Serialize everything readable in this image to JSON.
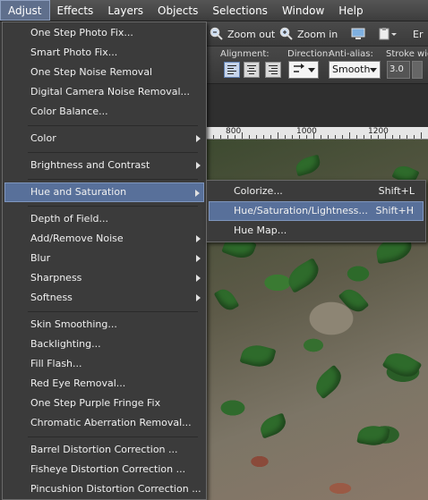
{
  "menubar": {
    "items": [
      "Adjust",
      "Effects",
      "Layers",
      "Objects",
      "Selections",
      "Window",
      "Help"
    ]
  },
  "toolbar": {
    "zoom_out": "Zoom out",
    "zoom_in": "Zoom in",
    "trailing": "Er",
    "alignment_label": "Alignment:",
    "direction_label": "Direction:",
    "antialias_label": "Anti-alias:",
    "stroke_label": "Stroke widt",
    "antialias_value": "Smooth",
    "stroke_value": "3.0"
  },
  "ruler": {
    "labels": [
      "800",
      "1000",
      "1200"
    ]
  },
  "adjust_menu": {
    "items": [
      {
        "label": "One Step Photo Fix...",
        "submenu": false
      },
      {
        "label": "Smart Photo Fix...",
        "submenu": false
      },
      {
        "label": "One Step Noise Removal",
        "submenu": false
      },
      {
        "label": "Digital Camera Noise Removal...",
        "submenu": false
      },
      {
        "label": "Color Balance...",
        "submenu": false
      },
      {
        "label": "Color",
        "submenu": true
      },
      {
        "label": "Brightness and Contrast",
        "submenu": true
      },
      {
        "label": "Hue and Saturation",
        "submenu": true
      },
      {
        "label": "Depth of Field...",
        "submenu": false
      },
      {
        "label": "Add/Remove Noise",
        "submenu": true
      },
      {
        "label": "Blur",
        "submenu": true
      },
      {
        "label": "Sharpness",
        "submenu": true
      },
      {
        "label": "Softness",
        "submenu": true
      },
      {
        "label": "Skin Smoothing...",
        "submenu": false
      },
      {
        "label": "Backlighting...",
        "submenu": false
      },
      {
        "label": "Fill Flash...",
        "submenu": false
      },
      {
        "label": "Red Eye Removal...",
        "submenu": false
      },
      {
        "label": "One Step Purple Fringe Fix",
        "submenu": false
      },
      {
        "label": "Chromatic Aberration Removal...",
        "submenu": false
      },
      {
        "label": "Barrel Distortion Correction ...",
        "submenu": false
      },
      {
        "label": "Fisheye Distortion Correction ...",
        "submenu": false
      },
      {
        "label": "Pincushion Distortion Correction ...",
        "submenu": false
      }
    ]
  },
  "hue_submenu": {
    "items": [
      {
        "label": "Colorize...",
        "shortcut": "Shift+L"
      },
      {
        "label": "Hue/Saturation/Lightness...",
        "shortcut": "Shift+H"
      },
      {
        "label": "Hue Map...",
        "shortcut": ""
      }
    ]
  },
  "colors": {
    "highlight": "#58709a",
    "menu_bg": "#3b3b3b"
  }
}
